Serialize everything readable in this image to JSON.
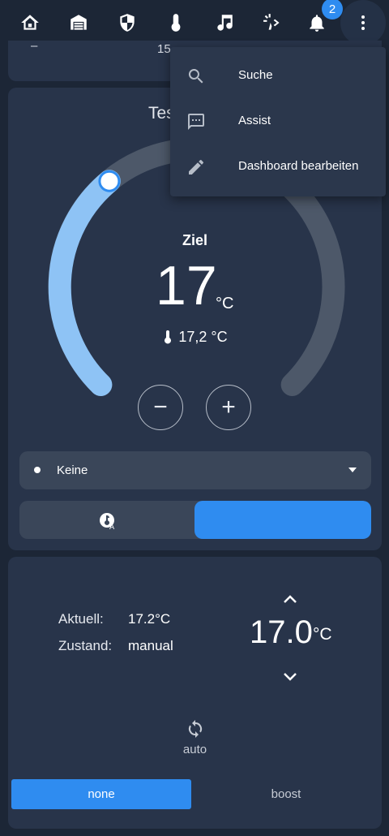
{
  "header": {
    "tabs": [
      {
        "name": "home",
        "icon": "home-icon"
      },
      {
        "name": "garage",
        "icon": "garage-icon"
      },
      {
        "name": "security",
        "icon": "shield-icon"
      },
      {
        "name": "climate",
        "icon": "thermometer-icon",
        "active": true
      },
      {
        "name": "music",
        "icon": "music-icon"
      },
      {
        "name": "lights",
        "icon": "light-sparkle-icon"
      }
    ],
    "notifications_count": "2"
  },
  "menu": {
    "items": [
      {
        "label": "Suche",
        "icon": "search-icon"
      },
      {
        "label": "Assist",
        "icon": "chat-icon"
      },
      {
        "label": "Dashboard bearbeiten",
        "icon": "pencil-icon"
      }
    ]
  },
  "top_card": {
    "partial_left": "–",
    "partial_center": "15"
  },
  "thermostat": {
    "title": "Tes",
    "target_label": "Ziel",
    "target_value": "17",
    "unit": "°C",
    "current_temp": "17,2 °C",
    "minus": "−",
    "plus": "+",
    "preset_select": "Keine",
    "accent": "#8ec3f5",
    "active_segment_color": "#2f8cf0"
  },
  "details": {
    "current_label": "Aktuell:",
    "current_value": "17.2°C",
    "state_label": "Zustand:",
    "state_value": "manual",
    "setpoint": "17.0",
    "setpoint_unit": "°C",
    "mode": "auto",
    "presets": [
      "none",
      "boost"
    ],
    "active_preset": "none"
  }
}
